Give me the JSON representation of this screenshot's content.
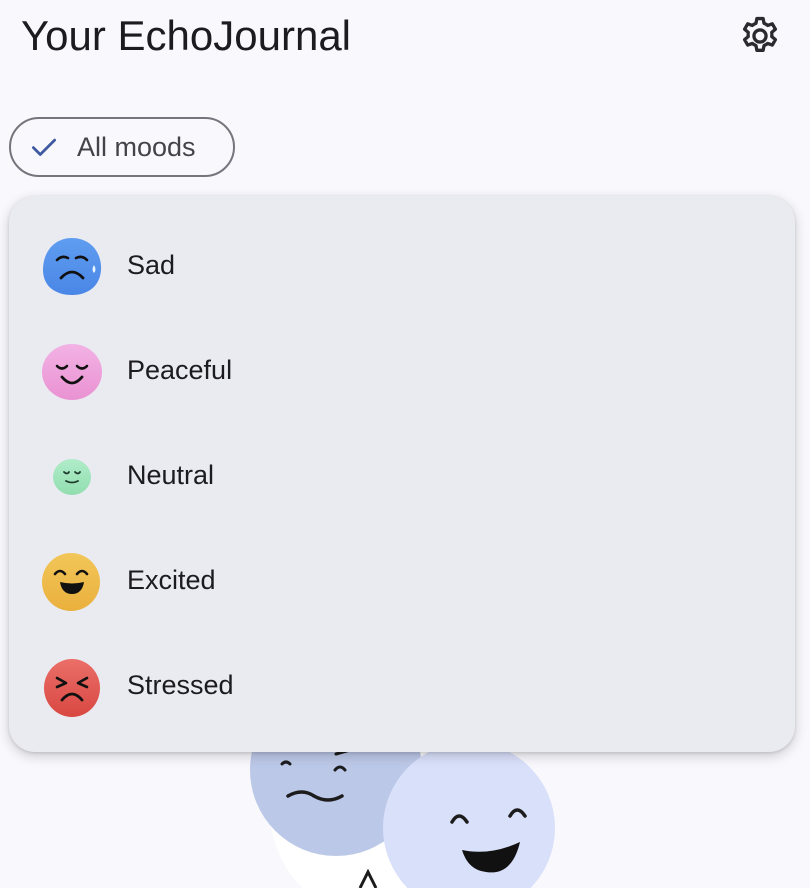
{
  "header": {
    "title": "Your EchoJournal",
    "settings_icon": "gear-icon"
  },
  "filter": {
    "chip_label": "All moods",
    "chip_icon": "check-icon",
    "selected": "All moods"
  },
  "mood_menu": {
    "items": [
      {
        "label": "Sad",
        "icon": "sad-face-icon",
        "color": "#5b95ee"
      },
      {
        "label": "Peaceful",
        "icon": "peaceful-face-icon",
        "color": "#ee9fd9"
      },
      {
        "label": "Neutral",
        "icon": "neutral-face-icon",
        "color": "#9fe4bb"
      },
      {
        "label": "Excited",
        "icon": "excited-face-icon",
        "color": "#f0bb47"
      },
      {
        "label": "Stressed",
        "icon": "stressed-face-icon",
        "color": "#e0554f"
      }
    ]
  },
  "colors": {
    "background": "#f8f8fd",
    "menu_surface": "#eaeaf1",
    "accent": "#3f5aa0"
  }
}
